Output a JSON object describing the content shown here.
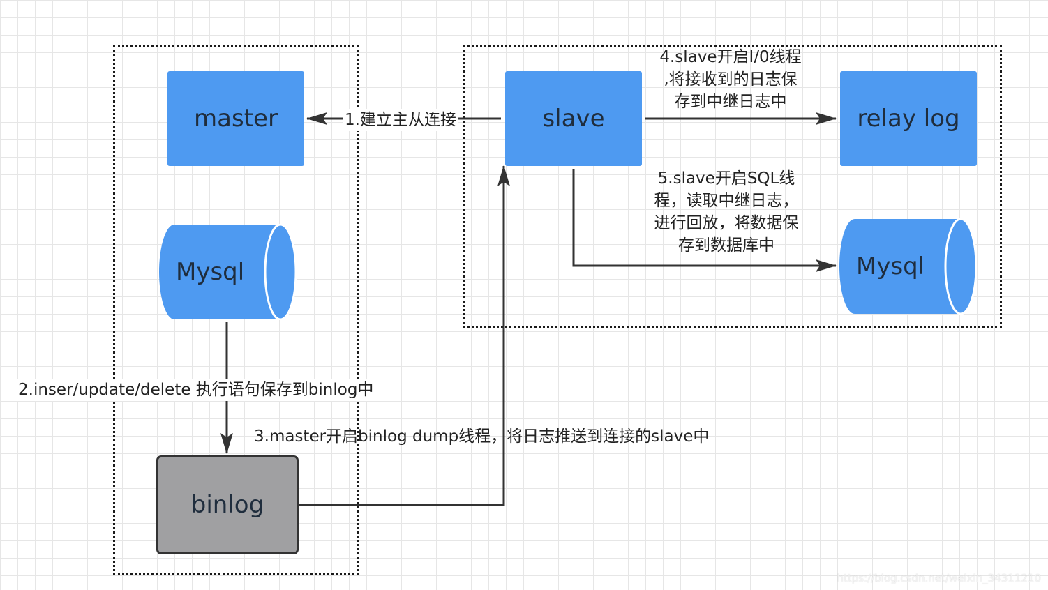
{
  "nodes": {
    "master": "master",
    "slave": "slave",
    "relay_log": "relay log",
    "mysql_master": "Mysql",
    "mysql_slave": "Mysql",
    "binlog": "binlog"
  },
  "steps": {
    "step1": "1.建立主从连接",
    "step2": "2.inser/update/delete 执行语句保存到binlog中",
    "step3": "3.master开启binlog dump线程，将日志推送到连接的slave中",
    "step4": [
      ",将接收到的日志保",
      "存到中继日志中"
    ],
    "step4_first": "4.slave开启I/0线程",
    "step5": [
      "5.slave开启SQL线",
      "程，读取中继日志，",
      "进行回放，将数据保",
      "存到数据库中"
    ]
  },
  "watermark": "https://blog.csdn.net/weixin_34311210",
  "colors": {
    "node_blue": "#4e9af1",
    "binlog_gray": "#a0a0a2",
    "line": "#333333"
  }
}
